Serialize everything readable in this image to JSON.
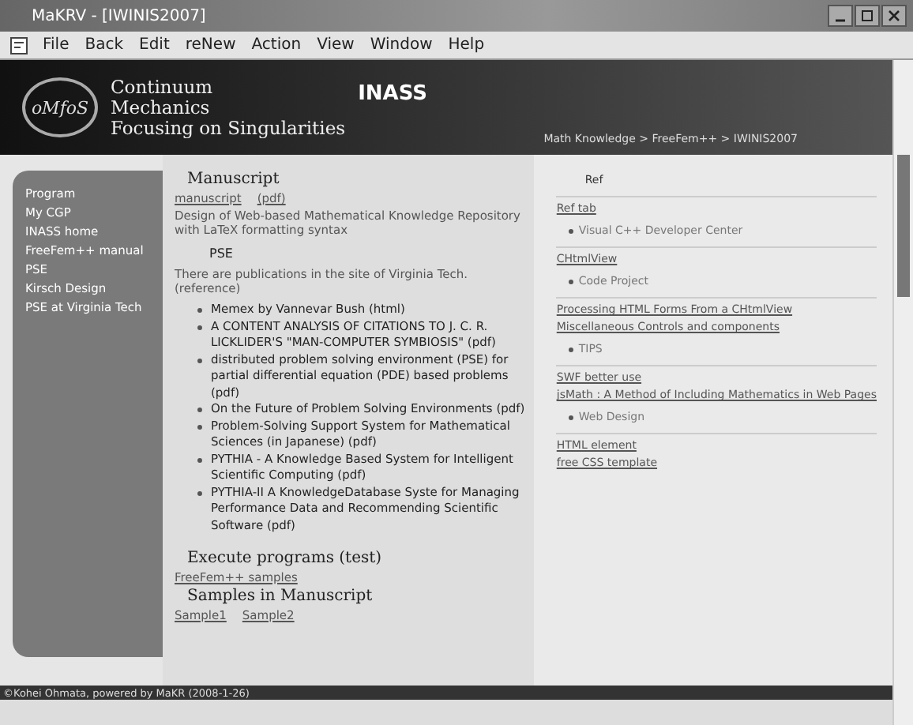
{
  "window": {
    "title": "MaKRV - [IWINIS2007]"
  },
  "menu": [
    {
      "label": "File"
    },
    {
      "label": "Back"
    },
    {
      "label": "Edit"
    },
    {
      "label": "reNew"
    },
    {
      "label": "Action"
    },
    {
      "label": "View"
    },
    {
      "label": "Window"
    },
    {
      "label": "Help"
    }
  ],
  "header": {
    "logo": "oMfoS",
    "lines": [
      "Continuum",
      "Mechanics",
      "Focusing on Singularities"
    ],
    "site": "INASS",
    "breadcrumb": "Math Knowledge > FreeFem++ > IWINIS2007"
  },
  "sidebar": {
    "items": [
      {
        "label": "Program"
      },
      {
        "label": "My CGP"
      },
      {
        "label": "INASS home"
      },
      {
        "label": "FreeFem++ manual"
      },
      {
        "label": "PSE"
      },
      {
        "label": "Kirsch Design"
      },
      {
        "label": "PSE at Virginia Tech"
      }
    ]
  },
  "main": [
    {
      "kind": "heading",
      "text": "Manuscript"
    },
    {
      "kind": "links",
      "items": [
        "manuscript",
        "(pdf)"
      ]
    },
    {
      "kind": "para",
      "text": "Design of Web-based Mathematical Knowledge Repository with LaTeX formatting syntax"
    },
    {
      "kind": "subheading",
      "text": "PSE"
    },
    {
      "kind": "para",
      "text": "There are publications in the site of Virginia Tech. (reference)"
    },
    {
      "kind": "bullets",
      "items": [
        "Memex by Vannevar Bush (html)",
        "A CONTENT ANALYSIS OF CITATIONS TO J. C. R. LICKLIDER'S \"MAN-COMPUTER SYMBIOSIS\" (pdf)",
        "distributed problem solving environment (PSE) for partial differential equation (PDE) based problems (pdf)",
        "On the Future of Problem Solving Environments (pdf)",
        "Problem-Solving Support System for Mathematical Sciences (in Japanese) (pdf)",
        "PYTHIA - A Knowledge Based System for Intelligent Scientific Computing (pdf)",
        "PYTHIA-II A KnowledgeDatabase Syste for Managing Performance Data and Recommending Scientific Software (pdf)"
      ]
    },
    {
      "kind": "heading",
      "text": "Execute programs (test)"
    },
    {
      "kind": "links",
      "items": [
        "FreeFem++ samples"
      ]
    },
    {
      "kind": "heading",
      "text": "Samples in Manuscript"
    },
    {
      "kind": "links",
      "items": [
        "Sample1",
        "Sample2"
      ]
    }
  ],
  "ref": {
    "title": "Ref",
    "groups": [
      {
        "links": [
          "Ref tab"
        ],
        "bullet": "Visual C++ Developer Center"
      },
      {
        "links": [
          "CHtmlView"
        ],
        "bullet": "Code Project"
      },
      {
        "links": [
          "Processing HTML Forms From a CHtmlView",
          "Miscellaneous Controls and components"
        ],
        "bullet": "TIPS"
      },
      {
        "links": [
          "SWF better use",
          "jsMath : A Method of Including Mathematics in Web Pages"
        ],
        "bullet": "Web Design"
      },
      {
        "links": [
          "HTML element",
          "free CSS template"
        ]
      }
    ]
  },
  "footer": "©Kohei Ohmata, powered by MaKR (2008-1-26)"
}
